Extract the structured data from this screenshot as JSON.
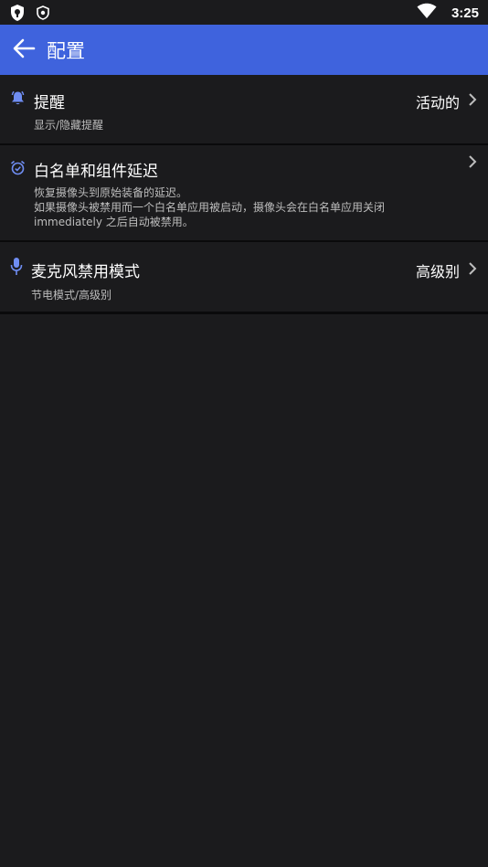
{
  "status_bar": {
    "time": "3:25",
    "icons": [
      "shield-icon",
      "badge-icon",
      "wifi-icon",
      "battery-icon"
    ]
  },
  "app_bar": {
    "title": "配置",
    "back_icon": "arrow-back-icon",
    "color": "#3f63dd"
  },
  "settings": [
    {
      "icon": "bell-icon",
      "title": "提醒",
      "subtitle": "显示/隐藏提醒",
      "value": "活动的"
    },
    {
      "icon": "alarm-check-icon",
      "title": "白名单和组件延迟",
      "subtitle_lines": [
        "恢复摄像头到原始装备的延迟。",
        "如果摄像头被禁用而一个白名单应用被启动，摄像头会在白名单应用关闭",
        "immediately 之后自动被禁用。"
      ]
    },
    {
      "icon": "microphone-icon",
      "title": "麦克风禁用模式",
      "subtitle": "节电模式/高级别",
      "value": "高级别"
    }
  ],
  "colors": {
    "background": "#1b1b1d",
    "icon_accent": "#6f8df2",
    "divider": "#0a0a0b"
  }
}
